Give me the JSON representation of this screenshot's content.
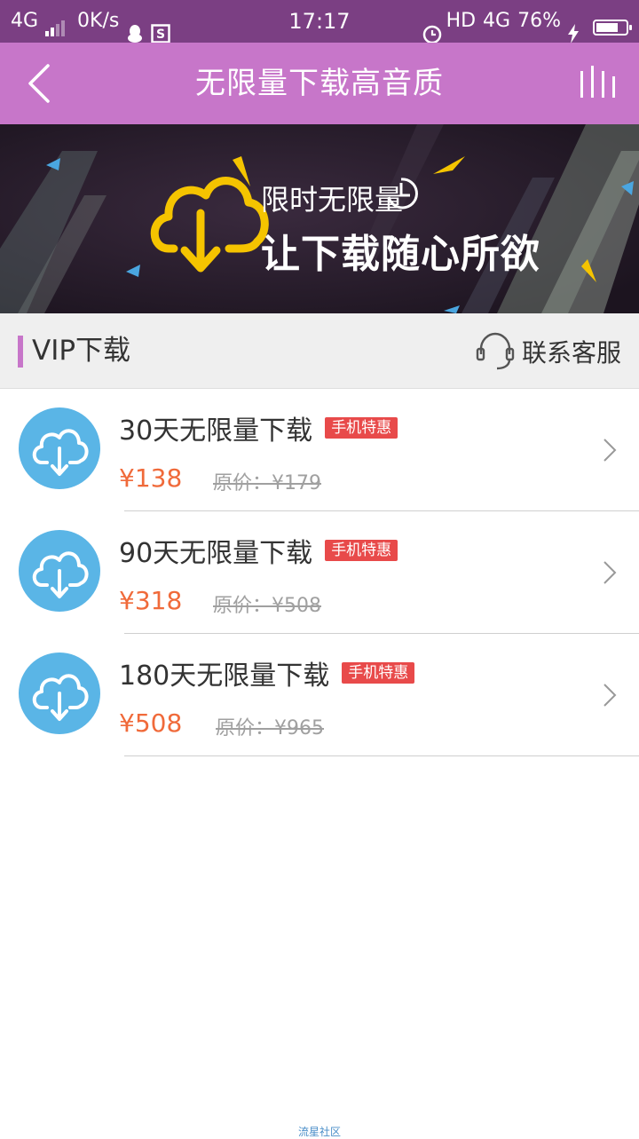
{
  "status_bar": {
    "network_left": "4G",
    "speed": "0K/s",
    "time": "17:17",
    "hd": "HD",
    "network_right": "4G",
    "battery": "76%",
    "battery_level": 0.76
  },
  "nav": {
    "title": "无限量下载高音质"
  },
  "banner": {
    "subtitle": "限时无限量",
    "headline": "让下载随心所欲"
  },
  "section": {
    "title": "VIP下载",
    "service_label": "联系客服"
  },
  "products": [
    {
      "name": "30天无限量下载",
      "badge": "手机特惠",
      "price": "¥138",
      "original_price": "原价：¥179"
    },
    {
      "name": "90天无限量下载",
      "badge": "手机特惠",
      "price": "¥318",
      "original_price": "原价：¥508"
    },
    {
      "name": "180天无限量下载",
      "badge": "手机特惠",
      "price": "¥508",
      "original_price": "原价：¥965"
    }
  ],
  "watermark": "流星社区",
  "colors": {
    "status_bar": "#7b3f83",
    "nav_bar": "#c776c9",
    "accent_price": "#f06a3a",
    "badge": "#e84a4a",
    "icon_circle": "#5ab5e6",
    "banner_cloud": "#f5c400"
  }
}
